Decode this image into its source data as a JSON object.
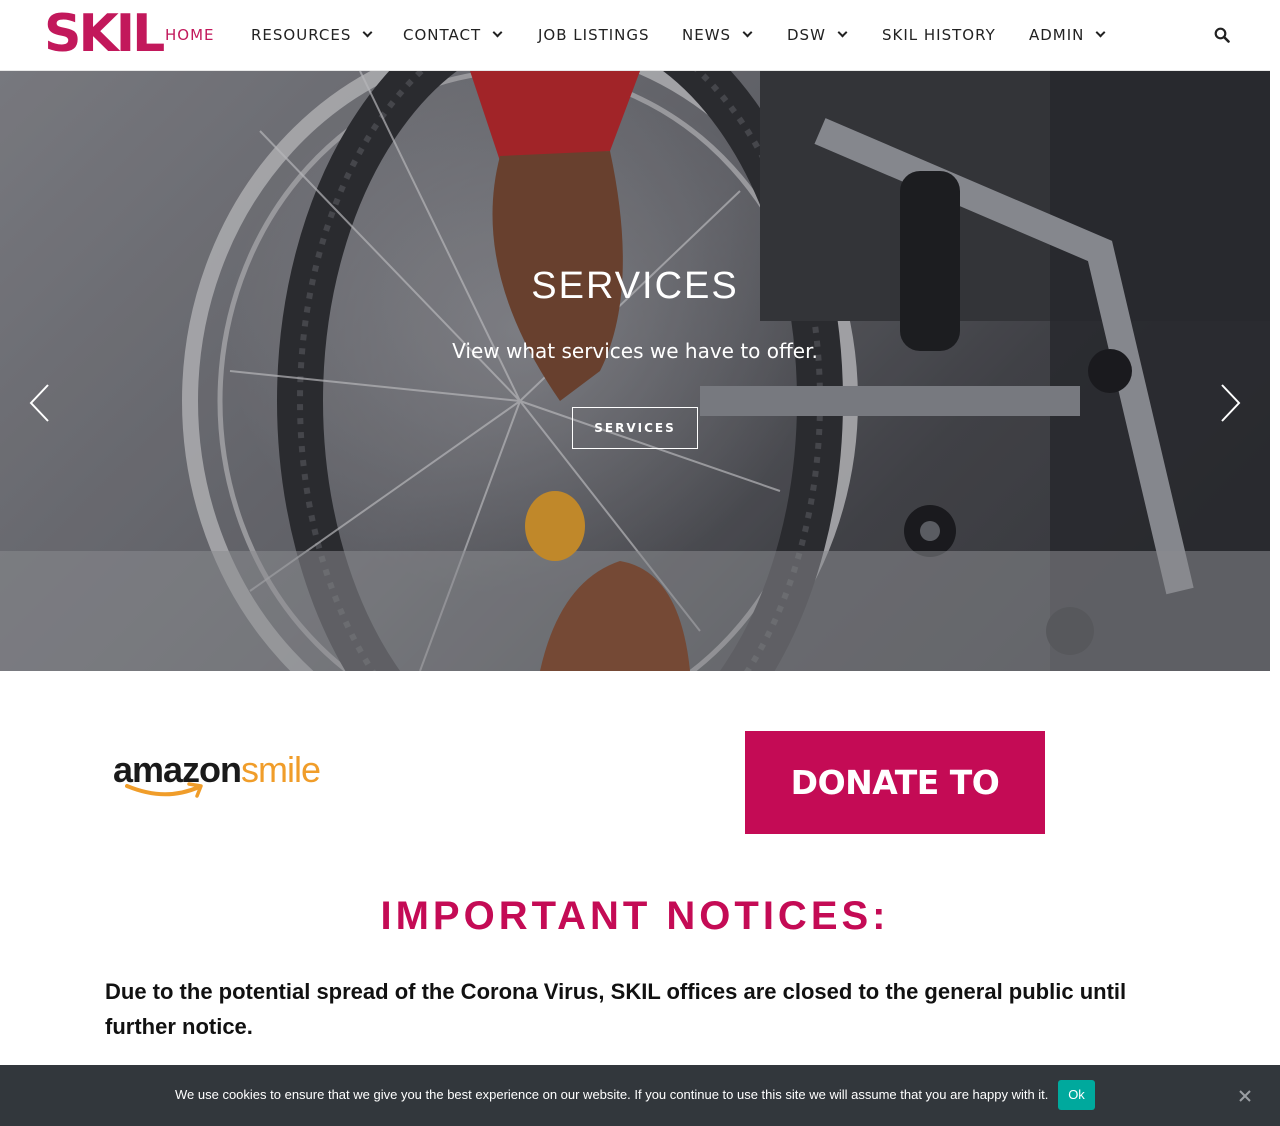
{
  "brand": {
    "logo_text": "SKIL",
    "accent_color": "#c40b55"
  },
  "nav": {
    "items": [
      {
        "label": "HOME",
        "active": true,
        "has_dropdown": false
      },
      {
        "label": "RESOURCES",
        "active": false,
        "has_dropdown": true
      },
      {
        "label": "CONTACT",
        "active": false,
        "has_dropdown": true
      },
      {
        "label": "JOB LISTINGS",
        "active": false,
        "has_dropdown": false
      },
      {
        "label": "NEWS",
        "active": false,
        "has_dropdown": true
      },
      {
        "label": "DSW",
        "active": false,
        "has_dropdown": true
      },
      {
        "label": "SKIL HISTORY",
        "active": false,
        "has_dropdown": false
      },
      {
        "label": "ADMIN",
        "active": false,
        "has_dropdown": true
      }
    ],
    "search_icon": "search-icon"
  },
  "hero": {
    "title": "SERVICES",
    "subtitle": "View what services we have to offer.",
    "button_label": "SERVICES",
    "prev_icon": "chevron-left-icon",
    "next_icon": "chevron-right-icon"
  },
  "badges": {
    "amazon_word_1": "amazon",
    "amazon_word_2": "smile",
    "donate_label": "DONATE TO SKIL"
  },
  "notices": {
    "title": "IMPORTANT NOTICES:",
    "text": "Due to the potential spread of the Corona Virus, SKIL offices are closed to the general public until further notice."
  },
  "cookie": {
    "message": "We use cookies to ensure that we give you the best experience on our website. If you continue to use this site we will assume that you are happy with it.",
    "ok_label": "Ok",
    "close_icon": "close-icon"
  }
}
